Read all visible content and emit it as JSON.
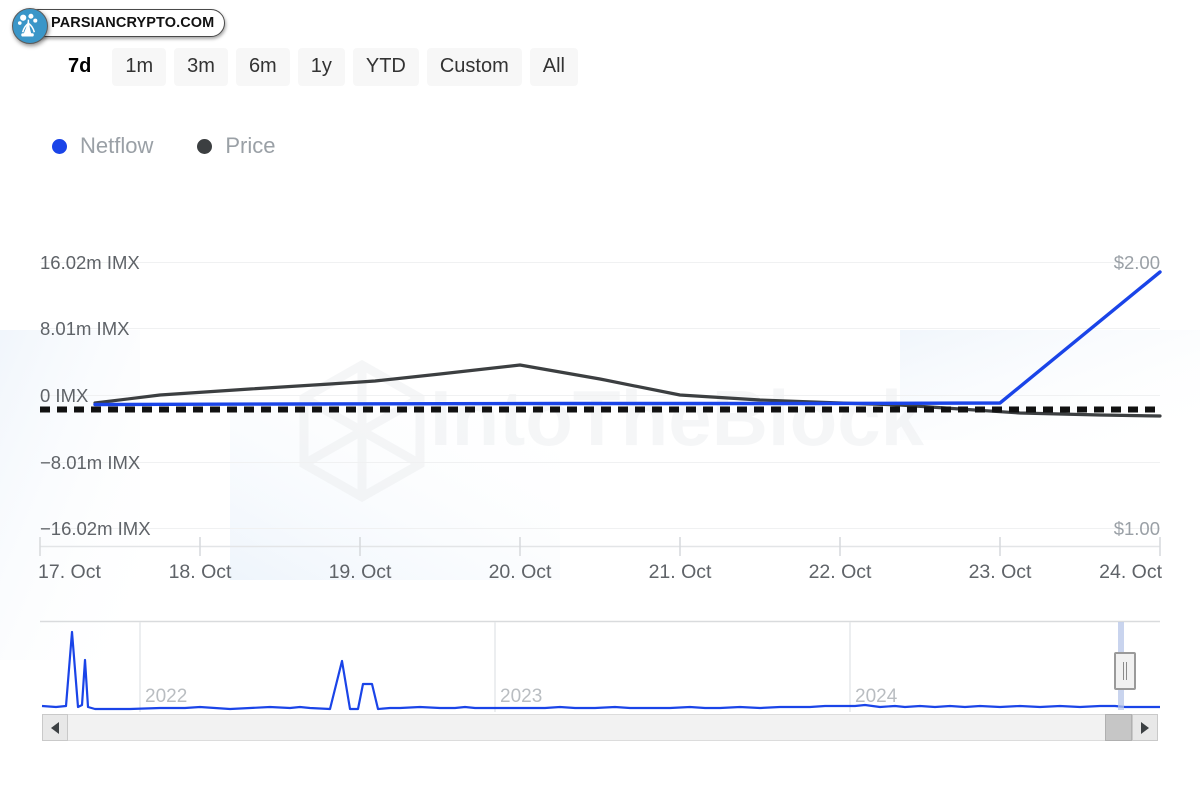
{
  "brand": {
    "name": "PARSIANCRYPTO.COM",
    "icon": "plant-logo-icon",
    "circle_color": "#3a96c8"
  },
  "range_selector": {
    "buttons": [
      {
        "label": "7d",
        "selected": true
      },
      {
        "label": "1m",
        "selected": false
      },
      {
        "label": "3m",
        "selected": false
      },
      {
        "label": "6m",
        "selected": false
      },
      {
        "label": "1y",
        "selected": false
      },
      {
        "label": "YTD",
        "selected": false
      },
      {
        "label": "Custom",
        "selected": false
      },
      {
        "label": "All",
        "selected": false
      }
    ]
  },
  "legend": {
    "items": [
      {
        "label": "Netflow",
        "color": "#1a44e8"
      },
      {
        "label": "Price",
        "color": "#3c3f41"
      }
    ]
  },
  "watermark": {
    "text": "IntoTheBlock",
    "logo": "hexagon-cube-icon"
  },
  "navigator": {
    "years": [
      "2022",
      "2023",
      "2024"
    ],
    "left_arrow": "chevron-left-icon",
    "right_arrow": "chevron-right-icon",
    "handle": "navigator-handle-grip"
  },
  "chart_data": {
    "type": "line",
    "title": "",
    "xlabel": "",
    "ylabel": "Netflow",
    "y2label": "Price",
    "grid": true,
    "legend_position": "top-left",
    "x_tick_labels": [
      "17. Oct",
      "18. Oct",
      "19. Oct",
      "20. Oct",
      "21. Oct",
      "22. Oct",
      "23. Oct",
      "24. Oct"
    ],
    "y_left_tick_labels": [
      "16.02m IMX",
      "8.01m IMX",
      "0 IMX",
      "−8.01m IMX",
      "−16.02m IMX"
    ],
    "y_left_tick_values": [
      16020000,
      8010000,
      0,
      -8010000,
      -16020000
    ],
    "y_right_tick_labels": [
      "$2.00",
      "$1.00"
    ],
    "y_right_tick_values": [
      2.0,
      1.0
    ],
    "ylim": [
      -16020000,
      16020000
    ],
    "y2lim": [
      1.0,
      2.0
    ],
    "zero_line": {
      "value": 0,
      "style": "dashed",
      "color": "#000000"
    },
    "series": [
      {
        "name": "Netflow",
        "color": "#1a44e8",
        "axis": "left",
        "x": [
          "17. Oct",
          "18. Oct",
          "19. Oct",
          "20. Oct",
          "21. Oct",
          "22. Oct",
          "23. Oct",
          "24. Oct"
        ],
        "values": [
          120000,
          140000,
          150000,
          150000,
          160000,
          170000,
          180000,
          16020000
        ]
      },
      {
        "name": "Price",
        "color": "#3c3f41",
        "axis": "right",
        "x": [
          "17. Oct",
          "18. Oct",
          "19. Oct",
          "20. Oct",
          "21. Oct",
          "22. Oct",
          "23. Oct",
          "24. Oct"
        ],
        "values": [
          1.475,
          1.52,
          1.545,
          1.575,
          1.525,
          1.505,
          1.495,
          1.47
        ]
      }
    ],
    "navigator_series": {
      "name": "Netflow",
      "color": "#1a44e8",
      "range": "All"
    }
  }
}
